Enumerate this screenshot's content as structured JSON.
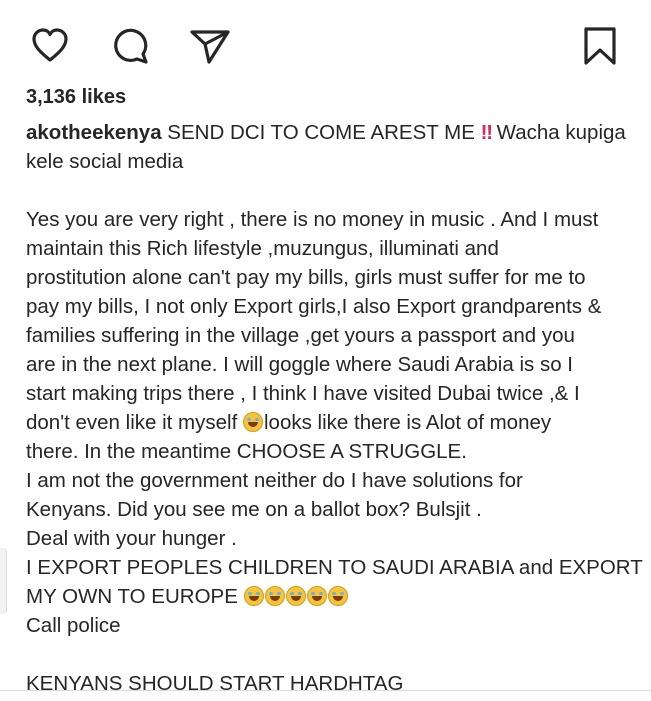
{
  "actions": {
    "like_icon": "heart-outline",
    "comment_icon": "speech-bubble",
    "share_icon": "paper-plane",
    "save_icon": "bookmark-outline"
  },
  "likes": {
    "count_text": "3,136 likes"
  },
  "caption": {
    "username": "akotheekenya",
    "lines": [
      " SEND DCI TO COME AREST ME ",
      "Wacha kupiga",
      "kele social media",
      "",
      "Yes you are very right , there is no money in music . And I must",
      "maintain this Rich lifestyle ,muzungus, illuminati and",
      "prostitution alone can't pay my bills,  girls must suffer for me to",
      "pay my bills, I not only Export girls,I also Export grandparents &",
      "families  suffering in the village ,get yours a passport and you",
      "are in the next plane. I will goggle where Saudi Arabia is so I",
      "start making trips there , I think I have visited Dubai twice ,& I",
      "don't even like it myself ",
      "looks like there is Alot of money",
      "there. In the meantime CHOOSE A STRUGGLE.",
      "I am not the government neither do I have solutions for",
      "Kenyans. Did you see me on a ballot box? Bulsjit .",
      "Deal with your hunger .",
      "I EXPORT PEOPLES CHILDREN TO SAUDI ARABIA and EXPORT",
      "MY OWN TO EUROPE ",
      "Call police",
      "",
      "KENYANS SHOULD START HARDHTAG"
    ],
    "double_exclamation": "‼",
    "emoji_name": "rolling-on-the-floor-laughing"
  },
  "colors": {
    "text": "#262626",
    "accent_red": "#e0245e",
    "divider": "#dbdbdb"
  }
}
